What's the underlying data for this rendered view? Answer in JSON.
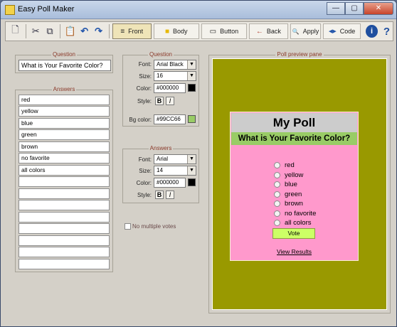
{
  "window": {
    "title": "Easy Poll Maker",
    "controls": [
      "—",
      "▢",
      "✕"
    ]
  },
  "toolbar": {
    "icons": [
      "new-document-icon",
      "cut-icon",
      "copy-icon",
      "paste-icon",
      "undo-icon",
      "redo-icon"
    ],
    "glyphs": {
      "new": "🗋",
      "cut": "✂",
      "copy": "⧉",
      "paste": "📋",
      "undo": "↶",
      "redo": "↷"
    },
    "buttons": [
      {
        "label": "Front",
        "icon": "≡"
      },
      {
        "label": "Body",
        "icon": "■"
      },
      {
        "label": "Button",
        "icon": "▭"
      },
      {
        "label": "Back",
        "icon": "←"
      },
      {
        "label": "Apply",
        "icon": "🔍"
      },
      {
        "label": "Code",
        "icon": "◀▶"
      }
    ],
    "info": "i",
    "help": "?"
  },
  "question_panel": {
    "legend": "Question",
    "value": "What is Your Favorite Color?"
  },
  "answers_panel": {
    "legend": "Answers",
    "rows": [
      "red",
      "yellow",
      "blue",
      "green",
      "brown",
      "no favorite",
      "all colors",
      "",
      "",
      "",
      "",
      "",
      "",
      "",
      ""
    ]
  },
  "question_style": {
    "legend": "Question",
    "font_label": "Font:",
    "font_value": "Arial Black",
    "size_label": "Size:",
    "size_value": "16",
    "color_label": "Color:",
    "color_value": "#000000",
    "style_label": "Style:",
    "bold": "B",
    "italic": "I",
    "bgcolor_label": "Bg color:",
    "bgcolor_value": "#99CC66"
  },
  "answers_style": {
    "legend": "Answers",
    "font_label": "Font:",
    "font_value": "Arial",
    "size_label": "Size:",
    "size_value": "14",
    "color_label": "Color:",
    "color_value": "#000000",
    "style_label": "Style:",
    "bold": "B",
    "italic": "I"
  },
  "no_multiple_votes": {
    "label": "No multiple votes",
    "checked": false
  },
  "preview": {
    "legend": "Poll preview pane",
    "poll_title": "My Poll",
    "question": "What is Your Favorite Color?",
    "options": [
      "red",
      "yellow",
      "blue",
      "green",
      "brown",
      "no favorite",
      "all colors"
    ],
    "vote_label": "Vote",
    "view_results": "View Results"
  },
  "colors": {
    "preview_bg": "#999900",
    "poll_bg": "#ff99cc",
    "title_bg": "#cccccc",
    "question_bg": "#99cc66",
    "vote_bg": "#ccff66",
    "text": "#000000"
  }
}
